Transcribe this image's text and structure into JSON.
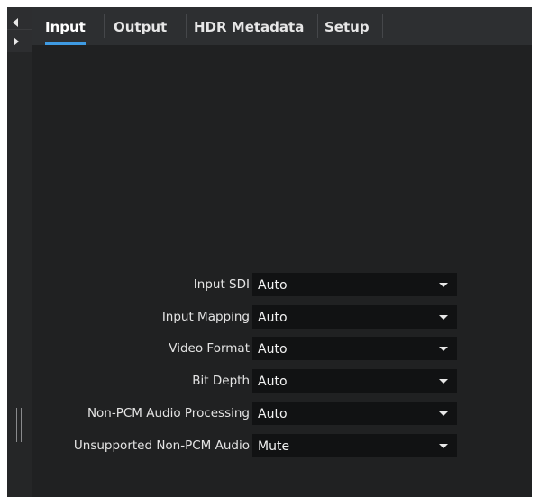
{
  "tabs": [
    {
      "label": "Input",
      "active": true
    },
    {
      "label": "Output",
      "active": false
    },
    {
      "label": "HDR Metadata",
      "active": false
    },
    {
      "label": "Setup",
      "active": false
    }
  ],
  "accent_color": "#3f9be3",
  "settings": [
    {
      "label": "Input SDI",
      "value": "Auto"
    },
    {
      "label": "Input Mapping",
      "value": "Auto"
    },
    {
      "label": "Video Format",
      "value": "Auto"
    },
    {
      "label": "Bit Depth",
      "value": "Auto"
    },
    {
      "label": "Non-PCM Audio Processing",
      "value": "Auto"
    },
    {
      "label": "Unsupported Non-PCM Audio",
      "value": "Mute"
    }
  ],
  "icons": {
    "collapse": "caret-left-icon",
    "expand": "caret-right-icon",
    "dropdown": "caret-down-icon",
    "grip": "resize-grip-icon"
  }
}
